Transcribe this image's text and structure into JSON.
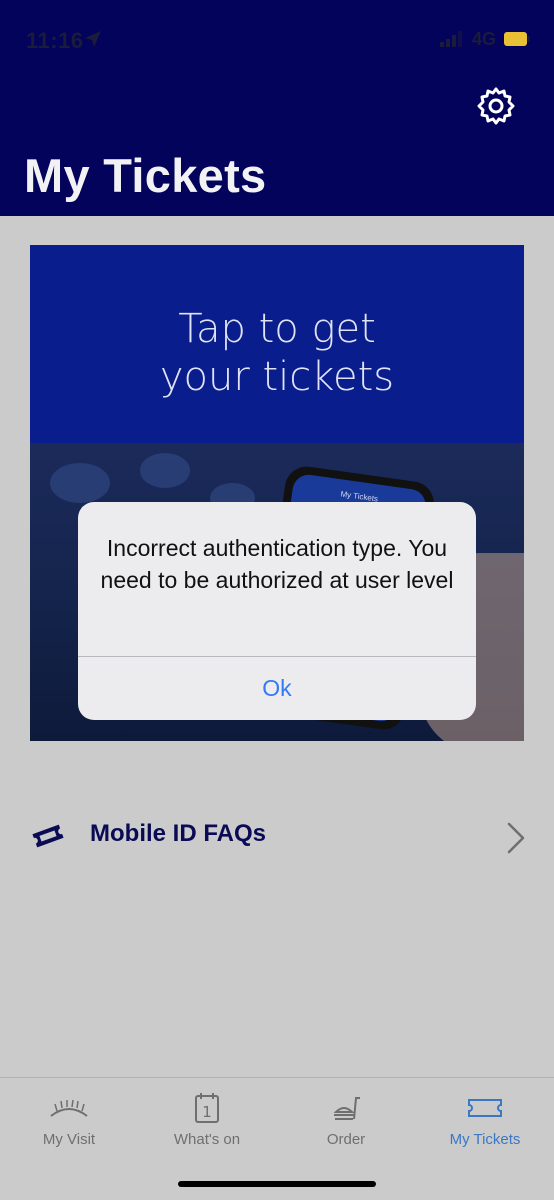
{
  "status_bar": {
    "time": "11:16",
    "network": "4G"
  },
  "header": {
    "title": "My Tickets"
  },
  "banner": {
    "text": "Tap to get\nyour tickets",
    "phone_label": "My Tickets"
  },
  "dialog": {
    "message": "Incorrect authentication type. You need to be authorized at user level",
    "ok_label": "Ok"
  },
  "faq": {
    "label": "Mobile ID FAQs"
  },
  "tabs": [
    {
      "label": "My Visit",
      "icon": "stadium-icon",
      "active": false
    },
    {
      "label": "What's on",
      "icon": "calendar-icon",
      "active": false
    },
    {
      "label": "Order",
      "icon": "food-order-icon",
      "active": false
    },
    {
      "label": "My Tickets",
      "icon": "ticket-icon",
      "active": true
    }
  ],
  "colors": {
    "header_bg": "#03035b",
    "banner_bg": "#0a1d8c",
    "accent": "#3478f6",
    "active_tab": "#3a78c4",
    "faq_text": "#0a0a55"
  }
}
